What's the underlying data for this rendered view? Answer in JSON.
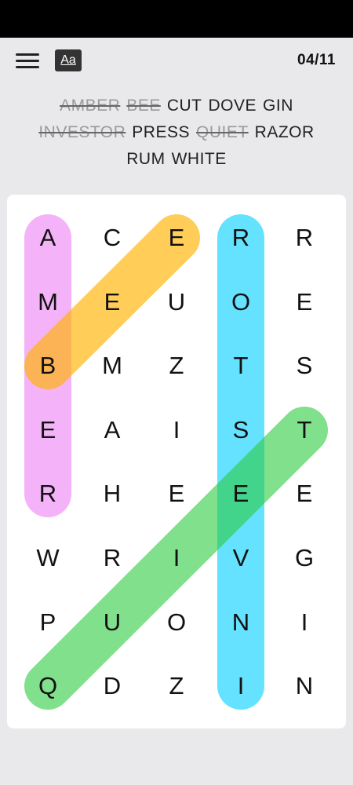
{
  "header": {
    "font_label": "Aa",
    "progress": "04/11"
  },
  "words": [
    [
      {
        "text": "AMBER",
        "found": true
      },
      {
        "text": "BEE",
        "found": true
      },
      {
        "text": "CUT",
        "found": false
      },
      {
        "text": "DOVE",
        "found": false
      },
      {
        "text": "GIN",
        "found": false
      }
    ],
    [
      {
        "text": "INVESTOR",
        "found": true
      },
      {
        "text": "PRESS",
        "found": false
      },
      {
        "text": "QUIET",
        "found": true
      },
      {
        "text": "RAZOR",
        "found": false
      }
    ],
    [
      {
        "text": "RUM",
        "found": false
      },
      {
        "text": "WHITE",
        "found": false
      }
    ]
  ],
  "grid": [
    [
      "A",
      "C",
      "E",
      "R",
      "R"
    ],
    [
      "M",
      "E",
      "U",
      "O",
      "E"
    ],
    [
      "B",
      "M",
      "Z",
      "T",
      "S"
    ],
    [
      "E",
      "A",
      "I",
      "S",
      "T"
    ],
    [
      "R",
      "H",
      "E",
      "E",
      "E"
    ],
    [
      "W",
      "R",
      "I",
      "V",
      "G"
    ],
    [
      "P",
      "U",
      "O",
      "N",
      "I"
    ],
    [
      "Q",
      "D",
      "Z",
      "I",
      "N"
    ]
  ],
  "highlights": [
    {
      "word": "AMBER",
      "color": "#ee82f4",
      "from": [
        0,
        0
      ],
      "to": [
        4,
        0
      ],
      "opacity": 0.6
    },
    {
      "word": "BEE",
      "color": "#ffb300",
      "from": [
        2,
        0
      ],
      "to": [
        0,
        2
      ],
      "opacity": 0.65
    },
    {
      "word": "INVESTOR",
      "color": "#00d0ff",
      "from": [
        7,
        3
      ],
      "to": [
        0,
        3
      ],
      "opacity": 0.6
    },
    {
      "word": "QUIET",
      "color": "#2ecc40",
      "from": [
        7,
        0
      ],
      "to": [
        3,
        4
      ],
      "opacity": 0.6
    }
  ]
}
